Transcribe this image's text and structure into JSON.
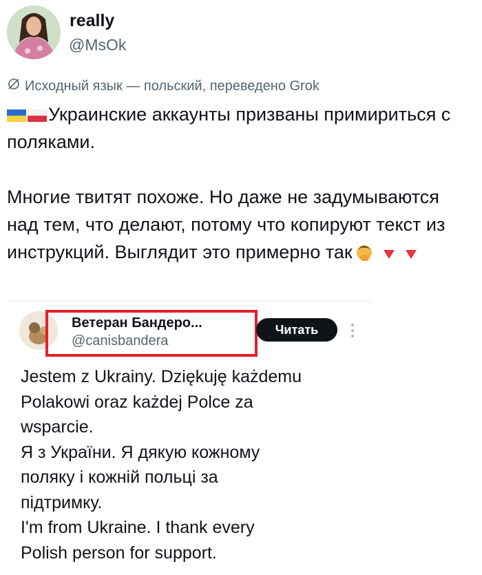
{
  "author": {
    "name": "really",
    "handle": "@MsOk"
  },
  "translation": {
    "note": "Исходный язык — польский, переведено Grok",
    "icon": "translate-icon"
  },
  "tweet": {
    "line1": "Украинские аккаунты призваны примириться с поляками.",
    "line2": "Многие твитят похоже. Но даже не задумываются над тем, что делают, потому что копируют текст из инструкций. Выглядит это примерно так"
  },
  "quoted": {
    "name": "Ветеран Бандеро...",
    "handle": "@canisbandera",
    "read_button": "Читать",
    "text": "Jestem z Ukrainy. Dziękuję każdemu\nPolakowi oraz każdej Polce za\nwsparcie.\nЯ з України. Я дякую кожному\nполяку і кожній польці за\nпідтримку.\n I'm from Ukraine. I thank every\nPolish person for support."
  },
  "colors": {
    "highlight": "#e51f2b",
    "secondary_text": "#536471",
    "button_bg": "#0f1419"
  }
}
